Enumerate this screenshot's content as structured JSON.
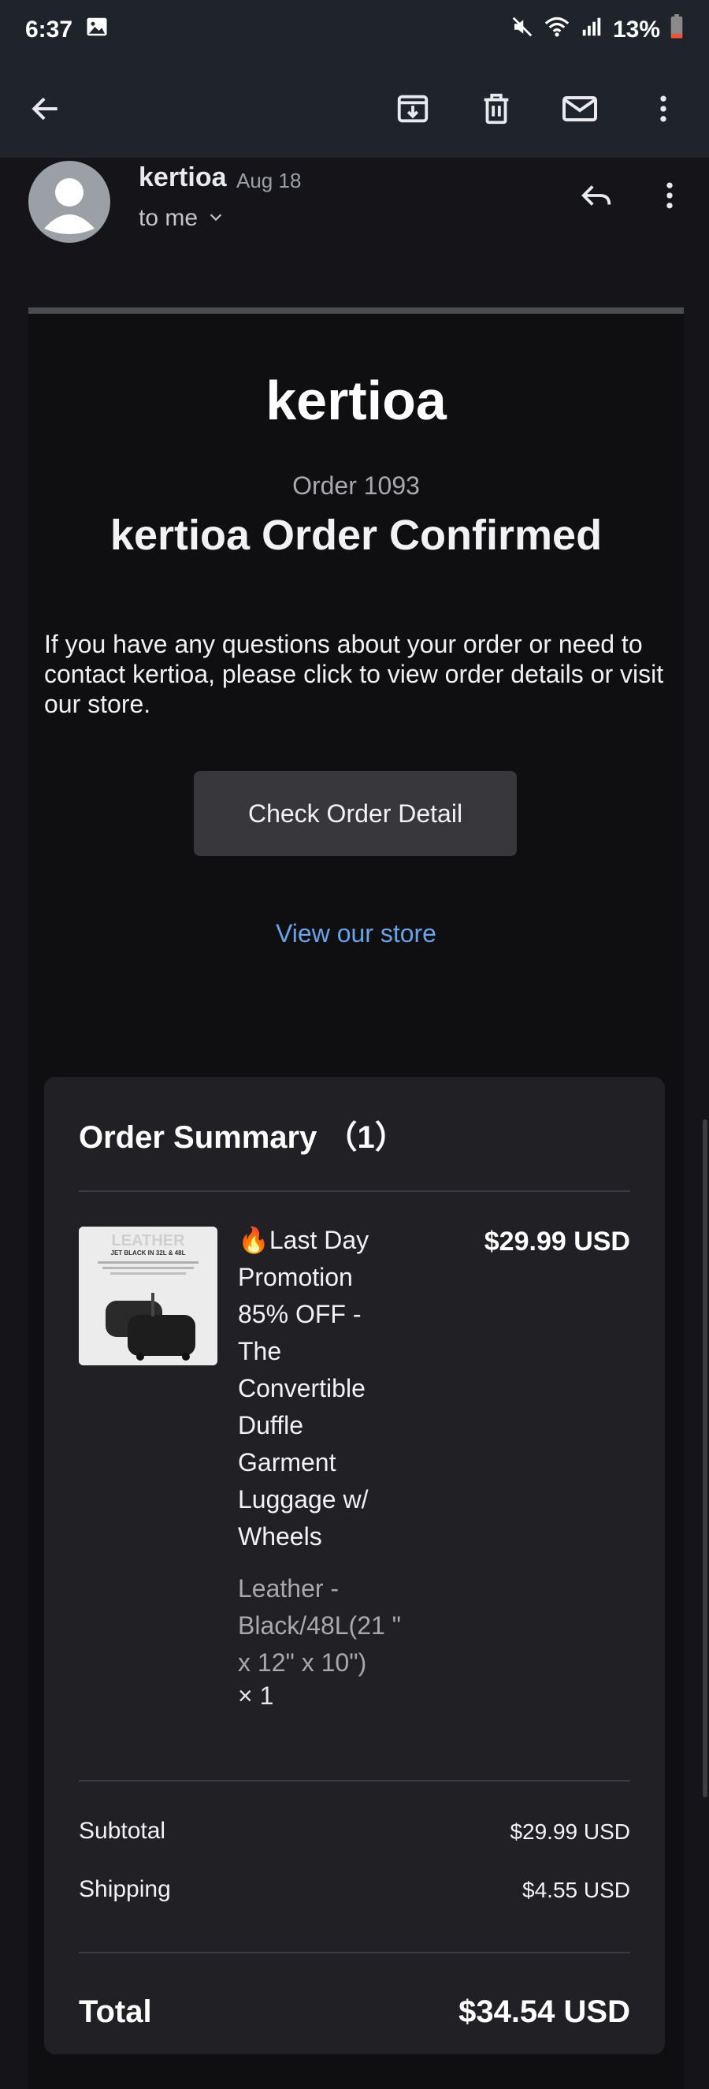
{
  "status_bar": {
    "time": "6:37",
    "battery_percent": "13%",
    "icons": [
      "image-icon",
      "mute-icon",
      "wifi-icon",
      "signal-icon",
      "battery-icon"
    ]
  },
  "toolbar": {
    "icons": [
      "back-arrow-icon",
      "archive-icon",
      "delete-icon",
      "mark-unread-icon",
      "more-vert-icon"
    ]
  },
  "message": {
    "sender": "kertioa",
    "date": "Aug 18",
    "recipient": "to me"
  },
  "email": {
    "brand": "kertioa",
    "order_number": "Order 1093",
    "title": "kertioa Order Confirmed",
    "intro": "If you have any questions about your order or need to contact kertioa, please click to view order details or visit our store.",
    "check_button": "Check Order Detail",
    "store_link": "View our store",
    "summary": {
      "title": "Order Summary （1）",
      "item": {
        "name": "🔥Last Day Promotion 85% OFF - The Convertible Duffle Garment Luggage w/ Wheels",
        "price": "$29.99 USD",
        "variant": "Leather - Black/48L(21 \" x 12\" x 10\")",
        "quantity": "× 1",
        "thumb_text": "LEATHER",
        "thumb_caption": "JET BLACK IN 32L & 48L"
      },
      "subtotal_label": "Subtotal",
      "subtotal_value": "$29.99 USD",
      "shipping_label": "Shipping",
      "shipping_value": "$4.55 USD",
      "total_label": "Total",
      "total_value": "$34.54 USD"
    }
  },
  "colors": {
    "app_bar": "#1f242c",
    "background": "#141419",
    "card": "#212125",
    "link": "#6aa3e6",
    "button": "#38383c"
  }
}
